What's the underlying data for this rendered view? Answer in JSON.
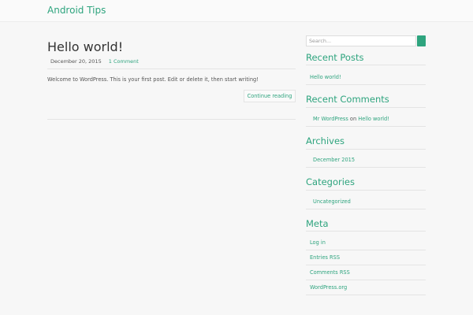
{
  "header": {
    "site_title": "Android Tips"
  },
  "post": {
    "title": "Hello world!",
    "date": "December 20, 2015",
    "comments": "1 Comment",
    "body": "Welcome to WordPress. This is your first post. Edit or delete it, then start writing!",
    "continue_label": "Continue reading"
  },
  "sidebar": {
    "search_placeholder": "Search...",
    "recent_posts": {
      "title": "Recent Posts",
      "items": [
        "Hello world!"
      ]
    },
    "recent_comments": {
      "title": "Recent Comments",
      "author": "Mr WordPress",
      "on": "on",
      "post": "Hello world!"
    },
    "archives": {
      "title": "Archives",
      "items": [
        "December 2015"
      ]
    },
    "categories": {
      "title": "Categories",
      "items": [
        "Uncategorized"
      ]
    },
    "meta": {
      "title": "Meta",
      "items": [
        "Log in",
        "Entries RSS",
        "Comments RSS",
        "WordPress.org"
      ]
    }
  },
  "colors": {
    "accent": "#2ea47e",
    "text": "#555555",
    "background": "#f7f7f7"
  }
}
